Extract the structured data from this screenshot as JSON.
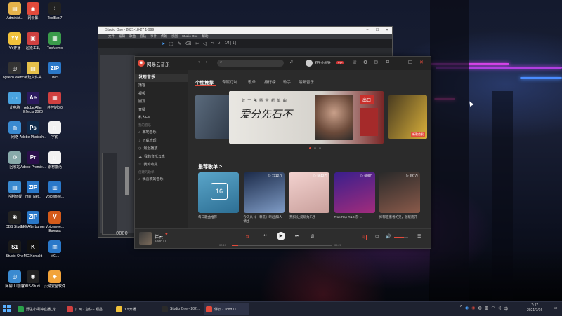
{
  "desktop": {
    "icons": [
      {
        "name": "administrator-folder-icon",
        "label": "Administ...",
        "color": "#e6b34a",
        "glyph": "▤"
      },
      {
        "name": "netease-cloud-icon",
        "label": "网云影",
        "color": "#e24a3b",
        "glyph": "◉"
      },
      {
        "name": "toolbar-icon",
        "label": "ToolBar.7",
        "color": "#222",
        "glyph": "⫶"
      },
      {
        "name": "yy-open-icon",
        "label": "YY开播",
        "color": "#f2c23a",
        "glyph": "YY"
      },
      {
        "name": "super-tools-icon",
        "label": "超级工具",
        "color": "#d04040",
        "glyph": "▣"
      },
      {
        "name": "topmemo-icon",
        "label": "TopMemo",
        "color": "#3a9b4a",
        "glyph": "▦"
      },
      {
        "name": "logitech-icon",
        "label": "Logitech Webca...",
        "color": "#333",
        "glyph": "◎"
      },
      {
        "name": "new-folder-icon",
        "label": "新建文件夹",
        "color": "#e6c04a",
        "glyph": "▤"
      },
      {
        "name": "tms-icon",
        "label": "TMS",
        "color": "#2a78c9",
        "glyph": "ZIP"
      },
      {
        "name": "this-pc-icon",
        "label": "此电脑",
        "color": "#4aa3e0",
        "glyph": "▭"
      },
      {
        "name": "after-effects-icon",
        "label": "Adobe After Effects 2020",
        "color": "#2b1a5e",
        "glyph": "Ae"
      },
      {
        "name": "quick-tools-icon",
        "label": "佳控制8.0",
        "color": "#d04040",
        "glyph": "▦"
      },
      {
        "name": "network-icon",
        "label": "网络",
        "color": "#3a8ad0",
        "glyph": "◍"
      },
      {
        "name": "photoshop-icon",
        "label": "Adobe Photosh...",
        "color": "#0f2a4a",
        "glyph": "Ps"
      },
      {
        "name": "doc-icon",
        "label": "字影",
        "color": "#f2f2f2",
        "glyph": "▯"
      },
      {
        "name": "recycle-bin-icon",
        "label": "回收站",
        "color": "#8aa",
        "glyph": "♻"
      },
      {
        "name": "premiere-icon",
        "label": "Adobe Premie...",
        "color": "#2a0f4a",
        "glyph": "Pr"
      },
      {
        "name": "assets-icon",
        "label": "素材激活",
        "color": "#f2f2f2",
        "glyph": "▯"
      },
      {
        "name": "control-panel-icon",
        "label": "控制面板",
        "color": "#3a8ad0",
        "glyph": "▤"
      },
      {
        "name": "intel-icon",
        "label": "Intel_Net...",
        "color": "#2a78c9",
        "glyph": "ZIP"
      },
      {
        "name": "voicemeeter-icon",
        "label": "Voicemee...",
        "color": "#2a78c9",
        "glyph": "▥"
      },
      {
        "name": "obs-studio-icon",
        "label": "OBS Studio",
        "color": "#222",
        "glyph": "◉"
      },
      {
        "name": "mg-afterburner-icon",
        "label": "MG Afterburner",
        "color": "#2a78c9",
        "glyph": "ZIP"
      },
      {
        "name": "voicemeeter-banana-icon",
        "label": "Voicemee... Banana",
        "color": "#d35a1a",
        "glyph": "V"
      },
      {
        "name": "studio-one-icon",
        "label": "Studio One",
        "color": "#1a1a1a",
        "glyph": "S1"
      },
      {
        "name": "mg-kontakt-icon",
        "label": "MG Kontakt",
        "color": "#111",
        "glyph": "K"
      },
      {
        "name": "mg-icon",
        "label": "MG...",
        "color": "#2a78c9",
        "glyph": "▥"
      },
      {
        "name": "network-monitor-icon",
        "label": "网易UU加速",
        "color": "#3a8ad0",
        "glyph": "◎"
      },
      {
        "name": "obs-studio-2-icon",
        "label": "OBS-Studi...",
        "color": "#222",
        "glyph": "◉"
      },
      {
        "name": "security-icon",
        "label": "火绒安全软件",
        "color": "#f2a33a",
        "glyph": "◆"
      }
    ]
  },
  "studio": {
    "title": "Studio One - 2021-18-27 1-999",
    "menu": [
      "文件",
      "编辑",
      "歌曲",
      "音轨",
      "事件",
      "传输",
      "视图",
      "Studio One",
      "帮助"
    ],
    "tool_value": "1/4 | 1 |"
  },
  "music": {
    "app_title": "网易云音乐",
    "search_placeholder": "",
    "user_name": "野生小闹钟",
    "vip_badge": "VIP",
    "sidebar": {
      "discover_label": "发现音乐",
      "items": [
        "播客",
        "视频",
        "朋友",
        "直播",
        "私人FM"
      ],
      "my_music_header": "我的音乐",
      "my_items": [
        "本地音乐",
        "下载管理",
        "最近播放",
        "我的音乐云盘",
        "我的收藏"
      ],
      "playlist_header": "创建的歌单",
      "playlist_items": [
        "我喜欢的音乐"
      ]
    },
    "tabs": [
      "个性推荐",
      "专属订制",
      "歌单",
      "排行榜",
      "歌手",
      "最新音乐"
    ],
    "banner": {
      "headline": "爱分先石不",
      "sub": "曾 一 苇 熙    全 新 单 曲",
      "tag": "出口",
      "badge": "新歌首发"
    },
    "recommended_header": "推荐歌单 >",
    "cards": [
      {
        "title": "每日歌曲推荐",
        "count": "",
        "color1": "#5aa5c9",
        "color2": "#2d6f94",
        "day": "16"
      },
      {
        "title": "今天从《一尊洗》听起|和人情出",
        "count": "▷ 7312万",
        "color1": "#1c2b4a",
        "color2": "#7f9cc6"
      },
      {
        "title": "[熊抖]让爱玩为乐手",
        "count": "▷ 5612万",
        "color1": "#f3d2cf",
        "color2": "#c9a09c"
      },
      {
        "title": "Trap Rap R&B 杂 ...",
        "count": "▷ 608万",
        "color1": "#3a1f8c",
        "color2": "#a22c7c"
      },
      {
        "title": "抑郁症患者的哭，温暖而开",
        "count": "▷ 897万",
        "color1": "#2a2a2a",
        "color2": "#8a5a4a"
      }
    ],
    "player": {
      "song": "伴云",
      "artist": "Todd Li",
      "elapsed": "00:17",
      "duration": "05:20",
      "progress": 0.06,
      "lyric_badge": "词",
      "volume": 0.7
    }
  },
  "taskbar": {
    "items": [
      {
        "name": "taskbar-chrome",
        "label": "野生小闹钟直播_给...",
        "color": "#2aa14a"
      },
      {
        "name": "taskbar-guangzhou",
        "label": "广州 - 急仔 - 顺昌...",
        "color": "#d04040"
      },
      {
        "name": "taskbar-yy",
        "label": "YY开播",
        "color": "#f2c23a"
      },
      {
        "name": "taskbar-studio-one",
        "label": "Studio One - 202...",
        "color": "#2a2a2a"
      },
      {
        "name": "taskbar-music",
        "label": "伴云 - Todd Li",
        "color": "#e24a3b"
      }
    ],
    "time": "7:47",
    "date": "2021/7/16",
    "lang": "中"
  }
}
